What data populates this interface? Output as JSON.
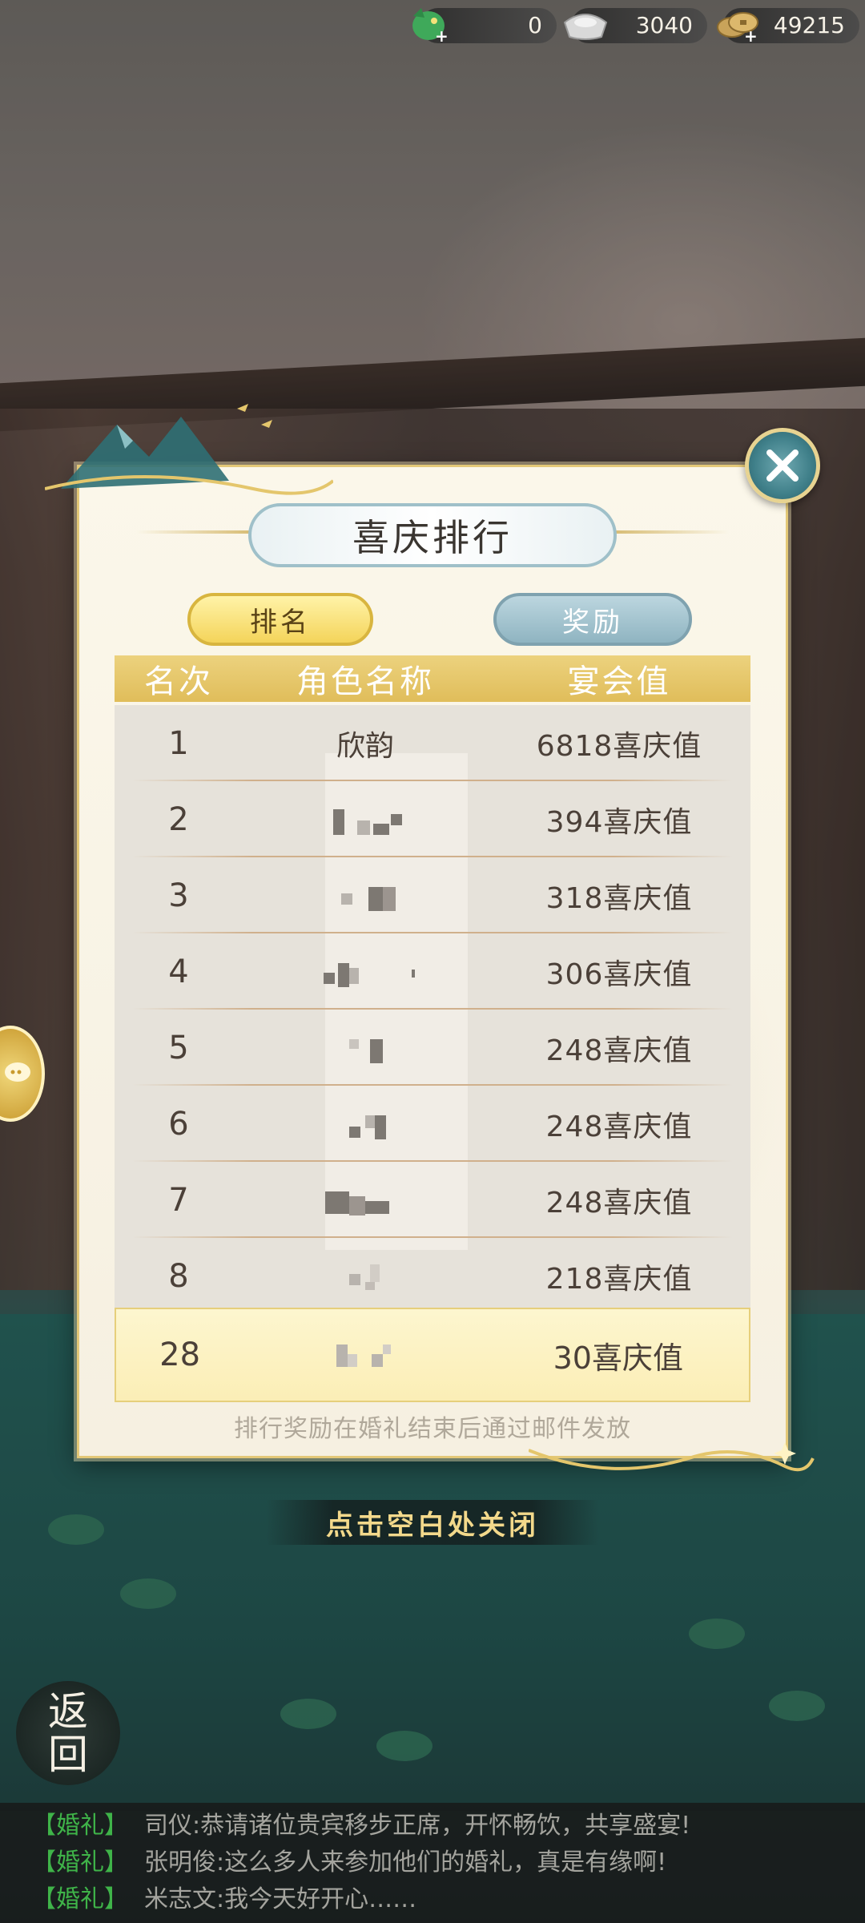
{
  "resources": [
    {
      "icon": "dragon-icon",
      "value": "0"
    },
    {
      "icon": "silver-ingot-icon",
      "value": "3040"
    },
    {
      "icon": "copper-coins-icon",
      "value": "49215"
    }
  ],
  "panel": {
    "title": "喜庆排行",
    "tabs": {
      "ranking": "排名",
      "rewards": "奖励"
    },
    "columns": {
      "rank": "名次",
      "name": "角色名称",
      "value": "宴会值"
    },
    "rows": [
      {
        "rank": "1",
        "name": "欣韵",
        "value": "6818喜庆值"
      },
      {
        "rank": "2",
        "name": "",
        "value": "394喜庆值"
      },
      {
        "rank": "3",
        "name": "",
        "value": "318喜庆值"
      },
      {
        "rank": "4",
        "name": "",
        "value": "306喜庆值"
      },
      {
        "rank": "5",
        "name": "",
        "value": "248喜庆值"
      },
      {
        "rank": "6",
        "name": "",
        "value": "248喜庆值"
      },
      {
        "rank": "7",
        "name": "",
        "value": "248喜庆值"
      },
      {
        "rank": "8",
        "name": "",
        "value": "218喜庆值"
      }
    ],
    "my_row": {
      "rank": "28",
      "name": "",
      "value": "30喜庆值"
    },
    "footer_note": "排行奖励在婚礼结束后通过邮件发放"
  },
  "tap_to_close": "点击空白处关闭",
  "back_button": {
    "line1": "返",
    "line2": "回"
  },
  "chat": [
    {
      "tag": "【婚礼】",
      "speaker": "司仪:",
      "text": "恭请诸位贵宾移步正席，开怀畅饮，共享盛宴!"
    },
    {
      "tag": "【婚礼】",
      "speaker": "张明俊:",
      "text": "这么多人来参加他们的婚礼，真是有缘啊!"
    },
    {
      "tag": "【婚礼】",
      "speaker": "米志文:",
      "text": "我今天好开心……"
    }
  ],
  "colors": {
    "accent_gold": "#e0bd5a",
    "active_tab": "#f4d45a",
    "inactive_tab": "#8fb4c1",
    "chat_tag": "#3fb449"
  }
}
